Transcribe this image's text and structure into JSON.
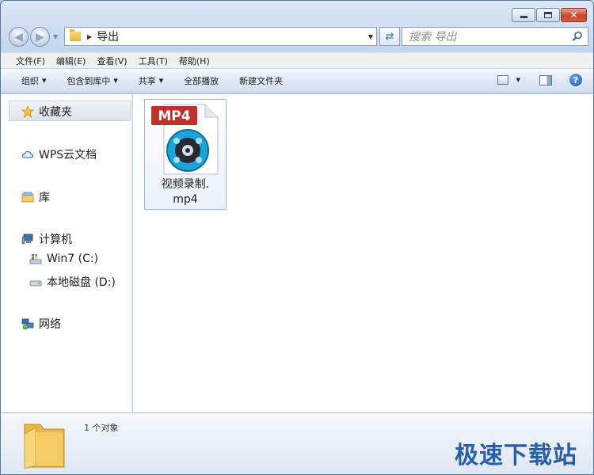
{
  "titlebar": {
    "min_label": "minimize",
    "max_label": "maximize",
    "close_label": "close"
  },
  "address": {
    "crumb": "导出"
  },
  "search": {
    "placeholder": "搜索 导出"
  },
  "menu": [
    "文件(F)",
    "编辑(E)",
    "查看(V)",
    "工具(T)",
    "帮助(H)"
  ],
  "commands": {
    "organize": "组织",
    "include": "包含到库中",
    "share": "共享",
    "play_all": "全部播放",
    "new_folder": "新建文件夹"
  },
  "navpane": {
    "favorites": "收藏夹",
    "wps": "WPS云文档",
    "libraries": "库",
    "computer": "计算机",
    "drive_c": "Win7 (C:)",
    "drive_d": "本地磁盘 (D:)",
    "network": "网络"
  },
  "file": {
    "name_line1": "视频录制.",
    "name_line2": "mp4",
    "badge": "MP4"
  },
  "details": {
    "count": "1 个对象"
  },
  "watermark": "极速下载站",
  "colors": {
    "accent": "#2b5ea8",
    "badge": "#c0312b",
    "film": "#1aa6d8"
  },
  "icons": [
    "back-arrow-icon",
    "forward-arrow-icon",
    "folder-icon",
    "refresh-icon",
    "search-icon",
    "star-icon",
    "cloud-icon",
    "library-icon",
    "computer-icon",
    "drive-icon",
    "network-icon",
    "help-icon"
  ]
}
